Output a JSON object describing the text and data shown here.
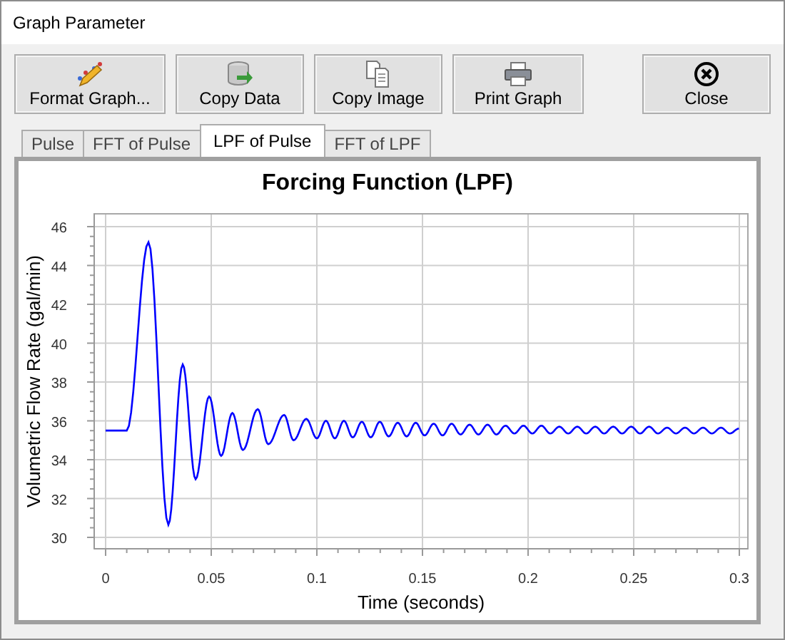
{
  "window": {
    "title": "Graph Parameter"
  },
  "toolbar": [
    {
      "label": "Format Graph...",
      "kind": "format"
    },
    {
      "label": "Copy Data",
      "kind": "copy-data"
    },
    {
      "label": "Copy Image",
      "kind": "copy-image"
    },
    {
      "label": "Print Graph",
      "kind": "print"
    },
    {
      "label": "Close",
      "kind": "close"
    }
  ],
  "tabs": [
    {
      "label": "Pulse",
      "selected": false
    },
    {
      "label": "FFT of Pulse",
      "selected": false
    },
    {
      "label": "LPF of Pulse",
      "selected": true
    },
    {
      "label": "FFT of LPF",
      "selected": false
    }
  ],
  "graph": {
    "chart_data": {
      "type": "line",
      "title": "Forcing Function (LPF)",
      "xlabel": "Time (seconds)",
      "ylabel": "Volumetric Flow Rate (gal/min)",
      "xlim": [
        0,
        0.3
      ],
      "ylim": [
        30,
        46
      ],
      "xticks": [
        0,
        0.05,
        0.1,
        0.15,
        0.2,
        0.25,
        0.3
      ],
      "yticks": [
        30,
        32,
        34,
        36,
        38,
        40,
        42,
        44,
        46
      ],
      "x": [
        0,
        0.01,
        0.0203,
        0.0297,
        0.0365,
        0.0426,
        0.049,
        0.0547,
        0.06,
        0.065,
        0.072,
        0.077,
        0.0845,
        0.089,
        0.095,
        0.1,
        0.1043,
        0.1085,
        0.1128,
        0.117,
        0.1213,
        0.1255,
        0.1298,
        0.134,
        0.1383,
        0.1425,
        0.1468,
        0.151,
        0.1553,
        0.1595,
        0.1638,
        0.168,
        0.1723,
        0.1765,
        0.1808,
        0.185,
        0.1893,
        0.1935,
        0.1978,
        0.202,
        0.2063,
        0.2105,
        0.2148,
        0.219,
        0.2233,
        0.2275,
        0.2318,
        0.236,
        0.2403,
        0.2445,
        0.2488,
        0.253,
        0.2573,
        0.2615,
        0.2658,
        0.27,
        0.2743,
        0.2785,
        0.2828,
        0.287,
        0.2913,
        0.2955,
        0.2998
      ],
      "grid": true,
      "series": [
        {
          "color": "#0000ff",
          "values": [
            35.5,
            35.5,
            45.2,
            30.65,
            38.9,
            33.0,
            37.25,
            34.2,
            36.4,
            34.5,
            36.6,
            34.8,
            36.3,
            35.0,
            36.1,
            35.1,
            36.0,
            35.1,
            36.0,
            35.15,
            35.95,
            35.15,
            35.95,
            35.2,
            35.9,
            35.2,
            35.9,
            35.25,
            35.85,
            35.25,
            35.85,
            35.3,
            35.8,
            35.3,
            35.8,
            35.3,
            35.75,
            35.35,
            35.75,
            35.35,
            35.75,
            35.35,
            35.7,
            35.35,
            35.7,
            35.35,
            35.7,
            35.35,
            35.7,
            35.35,
            35.7,
            35.35,
            35.7,
            35.35,
            35.65,
            35.35,
            35.65,
            35.35,
            35.65,
            35.35,
            35.65,
            35.35,
            35.6
          ]
        }
      ]
    }
  }
}
